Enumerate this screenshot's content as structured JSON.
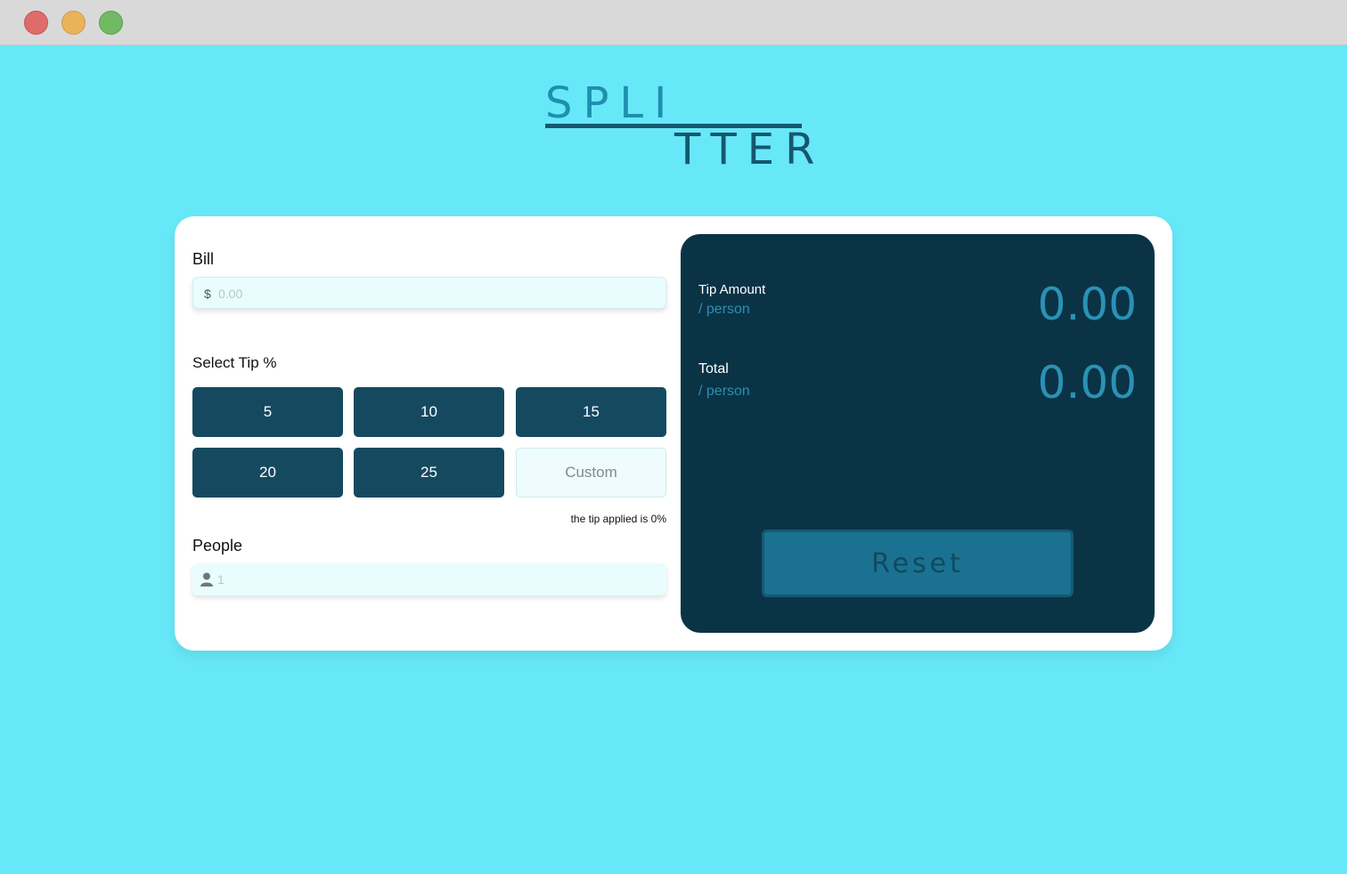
{
  "window": {
    "controls": [
      "close",
      "minimize",
      "maximize"
    ]
  },
  "logo": {
    "top": "SPLI",
    "bottom": "TTER"
  },
  "bill": {
    "label": "Bill",
    "currency": "$",
    "placeholder": "0.00"
  },
  "tip": {
    "label": "Select Tip %",
    "options": [
      "5",
      "10",
      "15",
      "20",
      "25"
    ],
    "custom_placeholder": "Custom",
    "note": "the tip applied is 0%"
  },
  "people": {
    "label": "People",
    "placeholder": "1"
  },
  "results": {
    "tip_amount": {
      "title": "Tip Amount",
      "sub": "/ person",
      "value": "0.00"
    },
    "total": {
      "title": "Total",
      "sub": "/ person",
      "value": "0.00"
    },
    "reset_label": "Reset"
  },
  "colors": {
    "background": "#67e8f8",
    "dark_teal": "#15495f",
    "result_panel": "#0b3346",
    "accent": "#2a92b5"
  }
}
